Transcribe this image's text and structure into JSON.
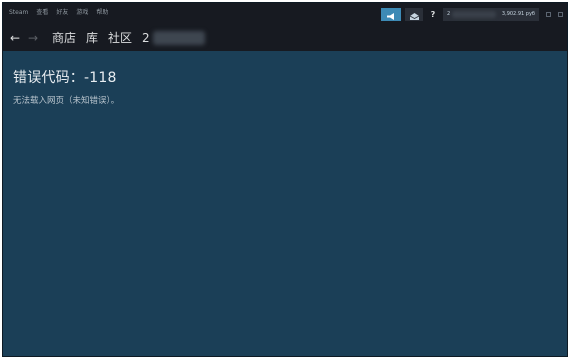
{
  "menu": {
    "items": [
      "Steam",
      "查看",
      "好友",
      "游戏",
      "帮助"
    ]
  },
  "account": {
    "number_prefix": "2",
    "balance": "3,902.91 руб"
  },
  "help_label": "?",
  "nav": {
    "back_glyph": "←",
    "forward_glyph": "→",
    "links": [
      "商店",
      "库",
      "社区"
    ],
    "user_prefix": "2"
  },
  "error": {
    "title": "错误代码：-118",
    "message": "无法载入网页（未知错误）。"
  },
  "colors": {
    "content_bg": "#1b3f57",
    "titlebar_bg": "#171a21",
    "accent_button": "#3d8ab5"
  },
  "icons": {
    "announce": "megaphone-icon",
    "mail": "envelope-icon"
  }
}
